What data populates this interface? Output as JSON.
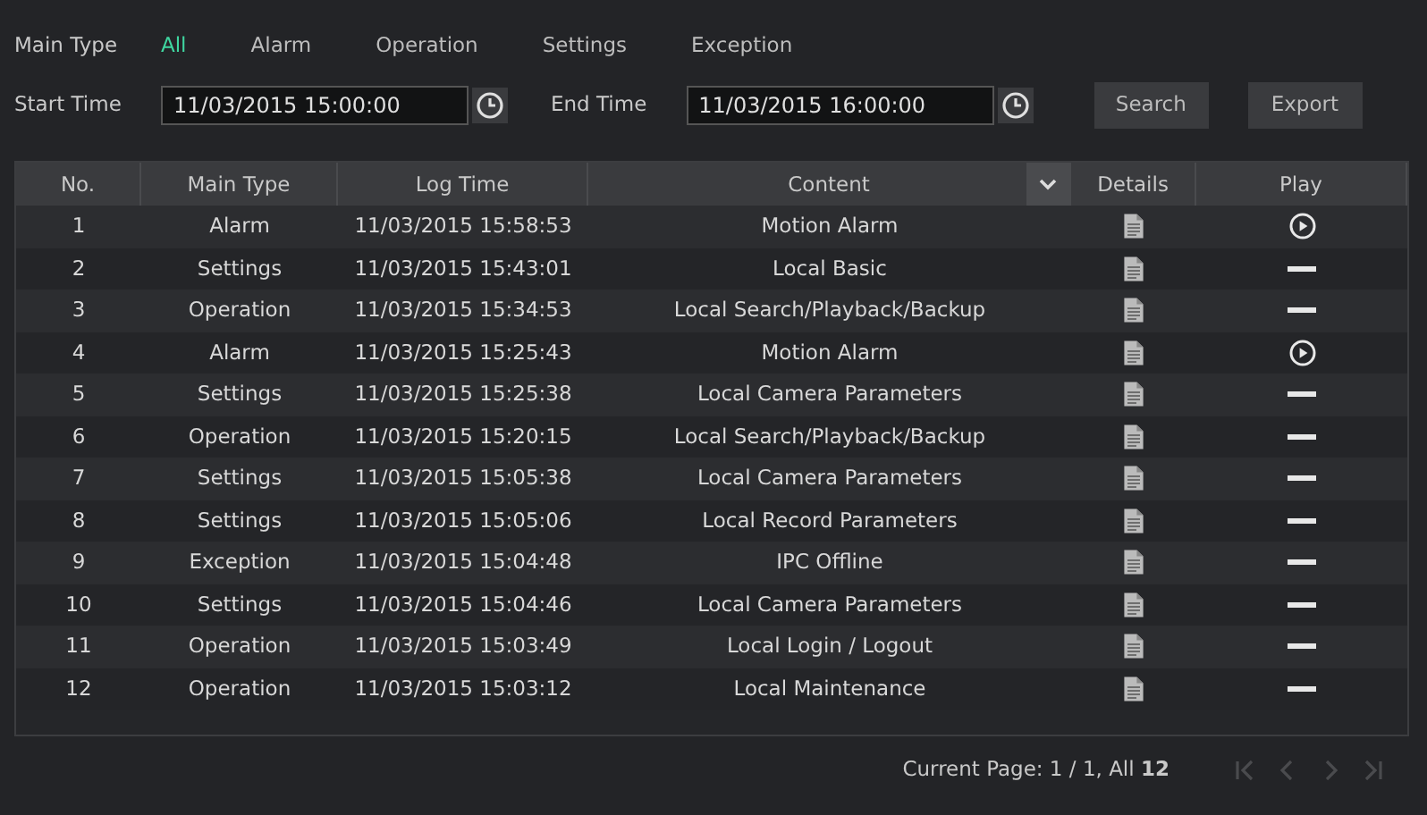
{
  "filter": {
    "label": "Main Type",
    "types": [
      {
        "label": "All",
        "selected": true
      },
      {
        "label": "Alarm",
        "selected": false
      },
      {
        "label": "Operation",
        "selected": false
      },
      {
        "label": "Settings",
        "selected": false
      },
      {
        "label": "Exception",
        "selected": false
      }
    ]
  },
  "time": {
    "start_label": "Start Time",
    "start_value": "11/03/2015 15:00:00",
    "end_label": "End Time",
    "end_value": "11/03/2015 16:00:00"
  },
  "buttons": [
    "Search",
    "Export"
  ],
  "table": {
    "columns": [
      "No.",
      "Main Type",
      "Log Time",
      "Content",
      "Details",
      "Play"
    ],
    "rows": [
      {
        "no": "1",
        "type": "Alarm",
        "time": "11/03/2015 15:58:53",
        "content": "Motion Alarm",
        "kind": "playable"
      },
      {
        "no": "2",
        "type": "Settings",
        "time": "11/03/2015 15:43:01",
        "content": "Local Basic",
        "kind": "none"
      },
      {
        "no": "3",
        "type": "Operation",
        "time": "11/03/2015 15:34:53",
        "content": "Local Search/Playback/Backup",
        "kind": "none"
      },
      {
        "no": "4",
        "type": "Alarm",
        "time": "11/03/2015 15:25:43",
        "content": "Motion Alarm",
        "kind": "playable"
      },
      {
        "no": "5",
        "type": "Settings",
        "time": "11/03/2015 15:25:38",
        "content": "Local Camera Parameters",
        "kind": "none"
      },
      {
        "no": "6",
        "type": "Operation",
        "time": "11/03/2015 15:20:15",
        "content": "Local Search/Playback/Backup",
        "kind": "none"
      },
      {
        "no": "7",
        "type": "Settings",
        "time": "11/03/2015 15:05:38",
        "content": "Local Camera Parameters",
        "kind": "none"
      },
      {
        "no": "8",
        "type": "Settings",
        "time": "11/03/2015 15:05:06",
        "content": "Local Record Parameters",
        "kind": "none"
      },
      {
        "no": "9",
        "type": "Exception",
        "time": "11/03/2015 15:04:48",
        "content": "IPC Offline",
        "kind": "none"
      },
      {
        "no": "10",
        "type": "Settings",
        "time": "11/03/2015 15:04:46",
        "content": "Local Camera Parameters",
        "kind": "none"
      },
      {
        "no": "11",
        "type": "Operation",
        "time": "11/03/2015 15:03:49",
        "content": "Local Login / Logout",
        "kind": "none"
      },
      {
        "no": "12",
        "type": "Operation",
        "time": "11/03/2015 15:03:12",
        "content": "Local Maintenance",
        "kind": "none"
      }
    ]
  },
  "pager": {
    "text": "Current Page: 1 / 1, All **12**",
    "first_disabled": true,
    "prev_disabled": true,
    "next_disabled": true,
    "last_disabled": true
  }
}
